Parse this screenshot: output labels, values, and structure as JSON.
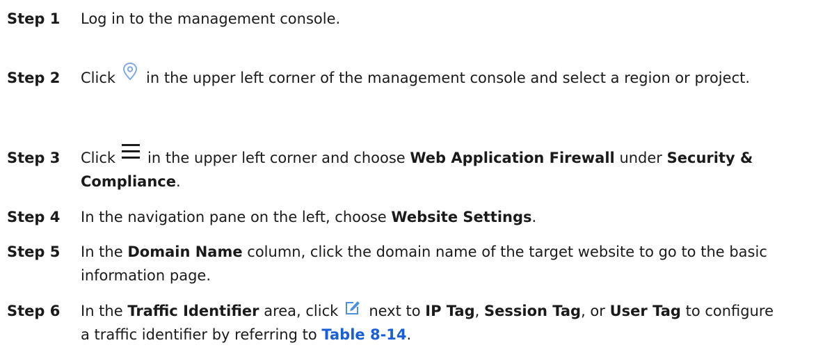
{
  "steps": [
    {
      "label": "Step 1",
      "text": "Log in to the management console."
    },
    {
      "label": "Step 2",
      "before": "Click",
      "icon": "location-pin-icon",
      "after": "in the upper left corner of the management console and select a region or project."
    },
    {
      "label": "Step 3",
      "before": "Click",
      "icon": "menu-icon",
      "after": "in the upper left corner and choose",
      "bold1": "Web Application Firewall",
      "mid": "under",
      "bold2": "Security & Compliance",
      "end": "."
    },
    {
      "label": "Step 4",
      "text": "In the navigation pane on the left, choose",
      "bold1": "Website Settings",
      "end": "."
    },
    {
      "label": "Step 5",
      "text": "In the",
      "bold1": "Domain Name",
      "after": "column, click the domain name of the target website to go to the basic information page."
    },
    {
      "label": "Step 6",
      "text": "In the",
      "bold1": "Traffic Identifier",
      "after": "area, click",
      "icon": "edit-icon",
      "after2": "next to",
      "bold2": "IP Tag",
      "comma": ",",
      "bold3": "Session Tag",
      "or": ", or",
      "bold4": "User Tag",
      "after3": "to configure a traffic identifier by referring to",
      "link": "Table 8-14",
      "end": "."
    }
  ],
  "colors": {
    "text": "#1a1a1a",
    "link": "#1a5fd8",
    "pin_icon": "#7fa9e8",
    "edit_icon": "#4a90e2"
  }
}
